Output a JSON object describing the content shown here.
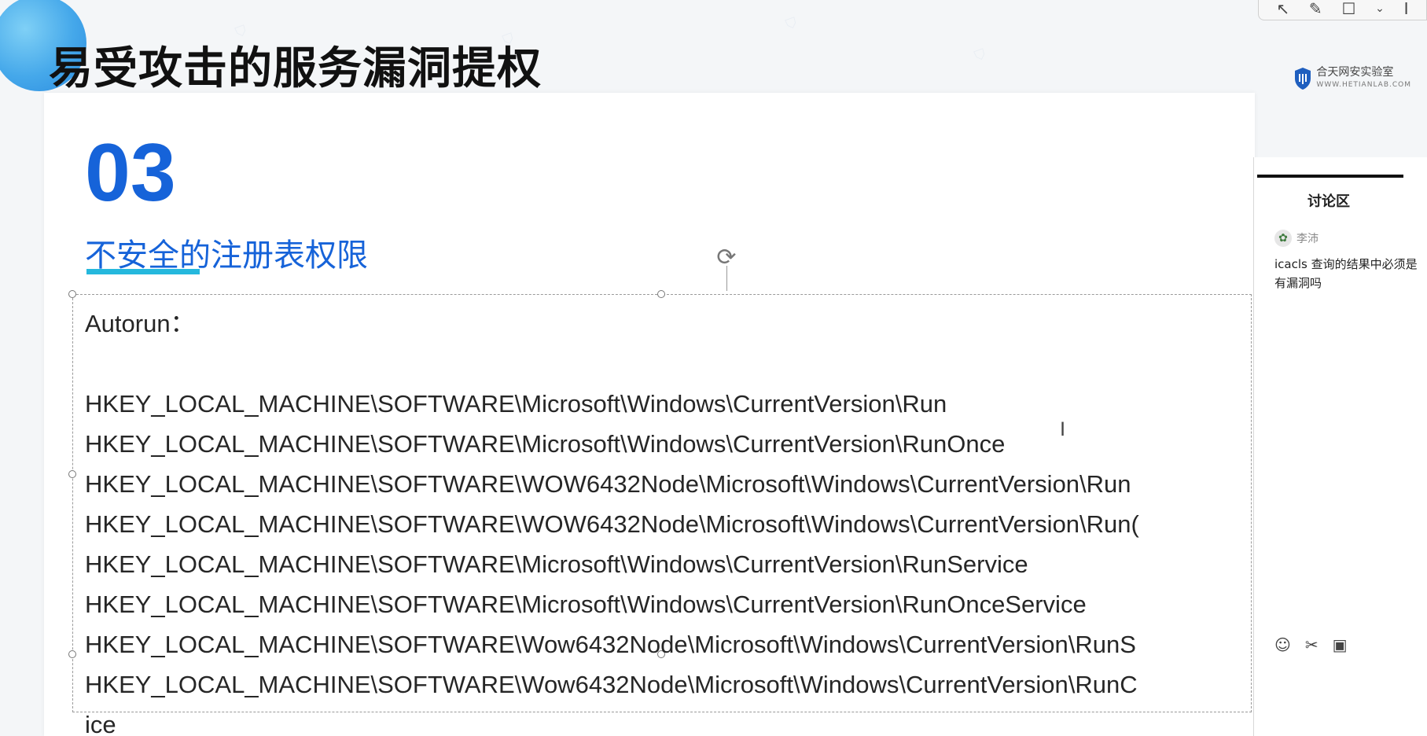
{
  "header": {
    "title": "易受攻击的服务漏洞提权",
    "logo_name": "合天网安实验室",
    "logo_url_text": "WWW.HETIANLAB.COM"
  },
  "toolbar": {
    "icons": [
      "cursor-icon",
      "pen-icon",
      "shape-icon"
    ]
  },
  "slide": {
    "section_number": "03",
    "section_title": "不安全的注册表权限",
    "lines": [
      "Autorun：",
      "",
      "HKEY_LOCAL_MACHINE\\SOFTWARE\\Microsoft\\Windows\\CurrentVersion\\Run",
      "HKEY_LOCAL_MACHINE\\SOFTWARE\\Microsoft\\Windows\\CurrentVersion\\RunOnce",
      "HKEY_LOCAL_MACHINE\\SOFTWARE\\WOW6432Node\\Microsoft\\Windows\\CurrentVersion\\Run",
      "HKEY_LOCAL_MACHINE\\SOFTWARE\\WOW6432Node\\Microsoft\\Windows\\CurrentVersion\\Run(",
      "HKEY_LOCAL_MACHINE\\SOFTWARE\\Microsoft\\Windows\\CurrentVersion\\RunService",
      "HKEY_LOCAL_MACHINE\\SOFTWARE\\Microsoft\\Windows\\CurrentVersion\\RunOnceService",
      "HKEY_LOCAL_MACHINE\\SOFTWARE\\Wow6432Node\\Microsoft\\Windows\\CurrentVersion\\RunS",
      "HKEY_LOCAL_MACHINE\\SOFTWARE\\Wow6432Node\\Microsoft\\Windows\\CurrentVersion\\RunC",
      "ice"
    ]
  },
  "discussion": {
    "title": "讨论区",
    "username": "李沛",
    "message": "icacls 查询的结果中必须是有漏洞吗",
    "actions": [
      "emoji-icon",
      "scissors-icon",
      "image-icon"
    ]
  },
  "colors": {
    "accent_blue": "#1663d9",
    "underline_cyan": "#25b8dd"
  }
}
